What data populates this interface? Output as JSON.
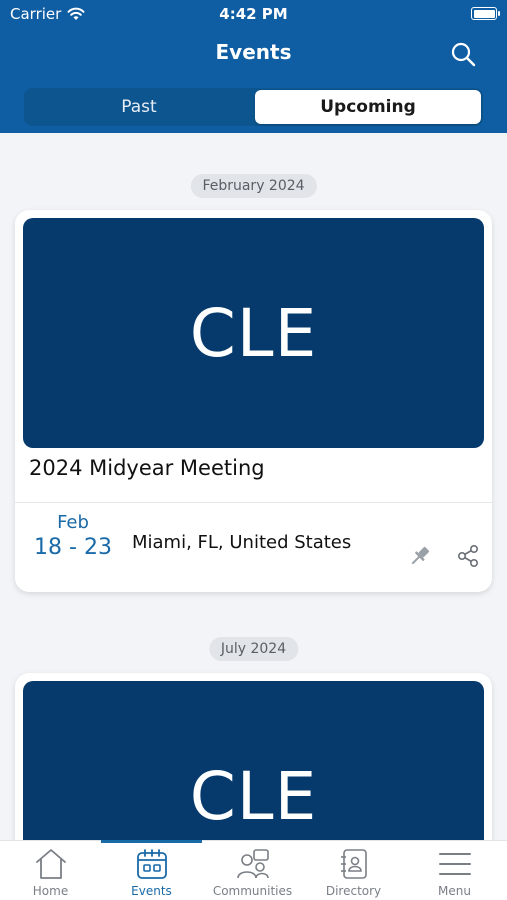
{
  "status": {
    "carrier": "Carrier",
    "time": "4:42 PM"
  },
  "header": {
    "title": "Events"
  },
  "segments": {
    "past": "Past",
    "upcoming": "Upcoming",
    "selected": "Upcoming"
  },
  "groups": [
    {
      "month": "February 2024",
      "event": {
        "image_text": "CLE",
        "title": "2024 Midyear Meeting",
        "date_month": "Feb",
        "date_range": "18 - 23",
        "location": "Miami, FL, United States"
      }
    },
    {
      "month": "July 2024",
      "event": {
        "image_text": "CLE"
      }
    }
  ],
  "tabs": [
    {
      "label": "Home",
      "icon": "home-icon"
    },
    {
      "label": "Events",
      "icon": "calendar-icon"
    },
    {
      "label": "Communities",
      "icon": "people-icon"
    },
    {
      "label": "Directory",
      "icon": "contact-book-icon"
    },
    {
      "label": "Menu",
      "icon": "hamburger-menu-icon"
    }
  ],
  "active_tab": "Events",
  "colors": {
    "primary": "#0f5ea3",
    "card_image": "#063a6c",
    "accent": "#1a6aa8",
    "background": "#f2f4f7"
  }
}
